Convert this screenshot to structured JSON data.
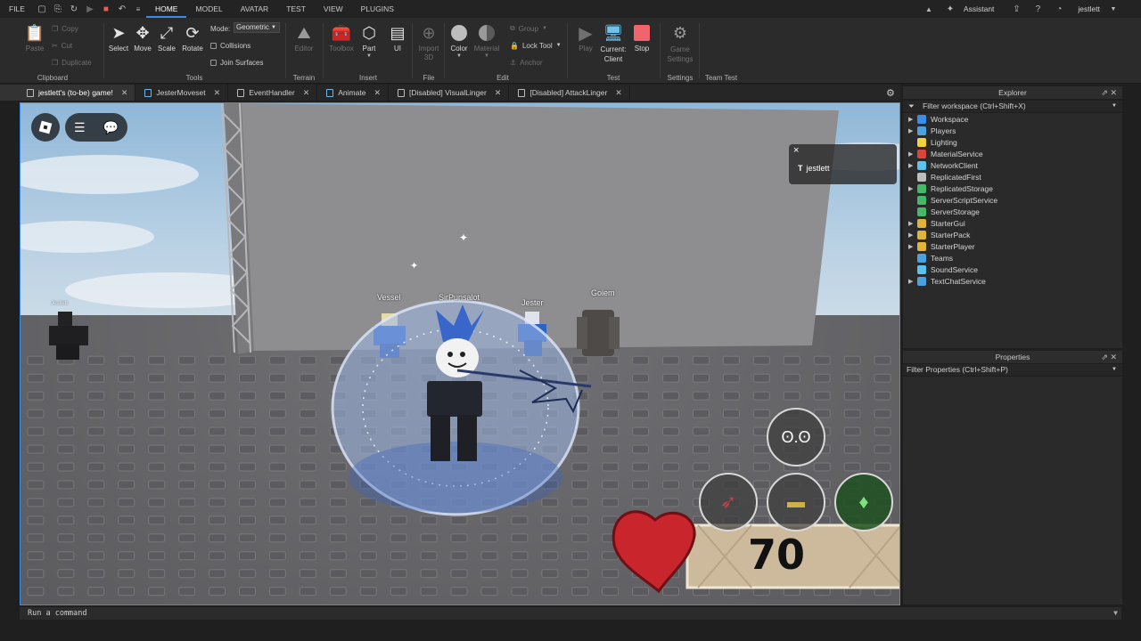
{
  "menubar": {
    "file": "FILE",
    "tabs": [
      "HOME",
      "MODEL",
      "AVATAR",
      "TEST",
      "VIEW",
      "PLUGINS"
    ],
    "active_tab": "HOME",
    "assistant": "Assistant",
    "username": "jestlett"
  },
  "ribbon": {
    "clipboard": {
      "label": "Clipboard",
      "paste": "Paste",
      "copy": "Copy",
      "cut": "Cut",
      "duplicate": "Duplicate"
    },
    "tools": {
      "label": "Tools",
      "select": "Select",
      "move": "Move",
      "scale": "Scale",
      "rotate": "Rotate",
      "mode_label": "Mode:",
      "mode_value": "Geometric",
      "collisions": "Collisions",
      "join_surfaces": "Join Surfaces"
    },
    "terrain": {
      "label": "Terrain",
      "editor": "Editor"
    },
    "insert": {
      "label": "Insert",
      "toolbox": "Toolbox",
      "part": "Part",
      "ui": "UI"
    },
    "file": {
      "label": "File",
      "import3d": "Import 3D"
    },
    "edit": {
      "label": "Edit",
      "color": "Color",
      "material": "Material",
      "group": "Group",
      "lock_tool": "Lock Tool",
      "anchor": "Anchor"
    },
    "test": {
      "label": "Test",
      "play": "Play",
      "current_client": "Current: Client",
      "stop": "Stop"
    },
    "settings": {
      "label": "Settings",
      "game_settings": "Game Settings"
    },
    "team_test": {
      "label": "Team Test"
    }
  },
  "doc_tabs": [
    {
      "label": "jestlett's (to-be) game!",
      "active": true
    },
    {
      "label": "JesterMoveset",
      "active": false
    },
    {
      "label": "EventHandler",
      "active": false
    },
    {
      "label": "Animate",
      "active": false
    },
    {
      "label": "[Disabled] VisualLinger",
      "active": false
    },
    {
      "label": "[Disabled] AttackLinger",
      "active": false
    }
  ],
  "viewport": {
    "player_card_name": "jestlett",
    "nametags": {
      "vessel": "Vessel",
      "sirpunsalot": "SirPunsalot",
      "jester": "Jester",
      "golem": "Golem",
      "far": "Jestlett"
    },
    "health": "70"
  },
  "explorer": {
    "title": "Explorer",
    "filter": "Filter workspace (Ctrl+Shift+X)",
    "items": [
      {
        "label": "Workspace",
        "expandable": true,
        "color": "#3a8eeb"
      },
      {
        "label": "Players",
        "expandable": true,
        "color": "#4aa3e0"
      },
      {
        "label": "Lighting",
        "expandable": false,
        "color": "#f2d23a"
      },
      {
        "label": "MaterialService",
        "expandable": true,
        "color": "#d9463b"
      },
      {
        "label": "NetworkClient",
        "expandable": true,
        "color": "#59c2ef"
      },
      {
        "label": "ReplicatedFirst",
        "expandable": false,
        "color": "#bdbdbd"
      },
      {
        "label": "ReplicatedStorage",
        "expandable": true,
        "color": "#45b86a"
      },
      {
        "label": "ServerScriptService",
        "expandable": false,
        "color": "#45b86a"
      },
      {
        "label": "ServerStorage",
        "expandable": false,
        "color": "#45b86a"
      },
      {
        "label": "StarterGui",
        "expandable": true,
        "color": "#e2b33c"
      },
      {
        "label": "StarterPack",
        "expandable": true,
        "color": "#e2b33c"
      },
      {
        "label": "StarterPlayer",
        "expandable": true,
        "color": "#e2b33c"
      },
      {
        "label": "Teams",
        "expandable": false,
        "color": "#4aa3e0"
      },
      {
        "label": "SoundService",
        "expandable": false,
        "color": "#59c2ef"
      },
      {
        "label": "TextChatService",
        "expandable": true,
        "color": "#4aa3e0"
      }
    ]
  },
  "properties": {
    "title": "Properties",
    "filter": "Filter Properties (Ctrl+Shift+P)"
  },
  "command_bar": {
    "placeholder": "Run a command"
  }
}
